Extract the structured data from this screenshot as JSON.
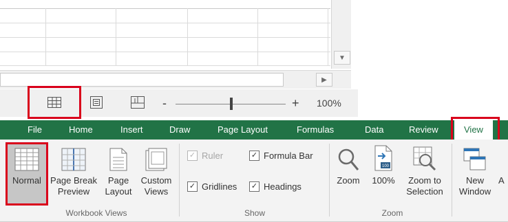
{
  "status_bar": {
    "zoom_minus": "-",
    "zoom_plus": "+",
    "zoom_level": "100%",
    "views": [
      {
        "name": "normal-view",
        "icon": "grid-icon"
      },
      {
        "name": "page-layout-view",
        "icon": "page-layout-icon"
      },
      {
        "name": "page-break-preview-view",
        "icon": "page-break-icon"
      }
    ]
  },
  "tabs": [
    "File",
    "Home",
    "Insert",
    "Draw",
    "Page Layout",
    "Formulas",
    "Data",
    "Review",
    "View"
  ],
  "ribbon": {
    "workbook_views": {
      "label": "Workbook Views",
      "buttons": [
        {
          "line1": "Normal",
          "line2": ""
        },
        {
          "line1": "Page Break",
          "line2": "Preview"
        },
        {
          "line1": "Page",
          "line2": "Layout"
        },
        {
          "line1": "Custom",
          "line2": "Views"
        }
      ]
    },
    "show": {
      "label": "Show",
      "ruler": "Ruler",
      "formula_bar": "Formula Bar",
      "gridlines": "Gridlines",
      "headings": "Headings",
      "check": "✓"
    },
    "zoom": {
      "label": "Zoom",
      "zoom": "Zoom",
      "zoom_100": "100%",
      "zoom_100_icon_text": "100",
      "zoom_to_selection_line1": "Zoom to",
      "zoom_to_selection_line2": "Selection"
    },
    "window": {
      "new_window_line1": "New",
      "new_window_line2": "Window",
      "partial_next": "A"
    }
  },
  "colors": {
    "excel_green": "#217346",
    "highlight_red": "#d9001b"
  }
}
